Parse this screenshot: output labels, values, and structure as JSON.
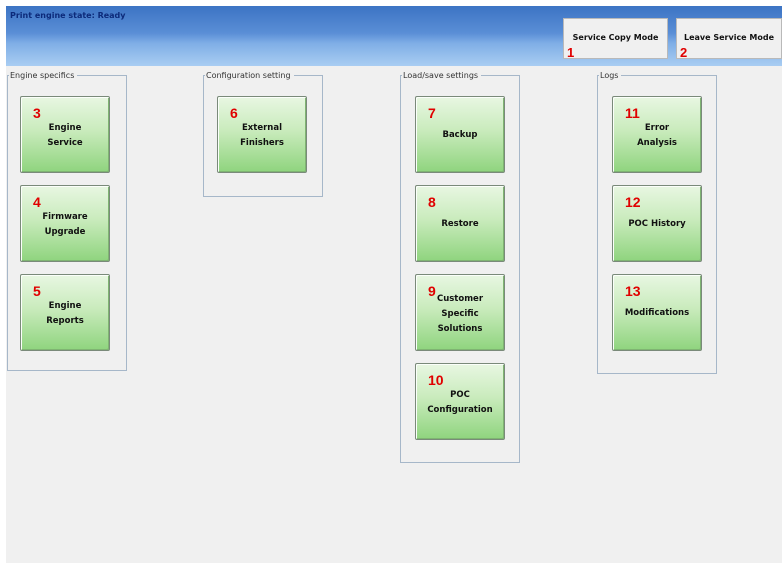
{
  "status": "Print engine state: Ready",
  "header_buttons": [
    {
      "num": "1",
      "label": "Service Copy Mode"
    },
    {
      "num": "2",
      "label": "Leave Service Mode"
    }
  ],
  "groups": {
    "engine_specifics": {
      "title": "Engine specifics",
      "tiles": [
        {
          "num": "3",
          "label": "Engine\nService"
        },
        {
          "num": "4",
          "label": "Firmware\nUpgrade"
        },
        {
          "num": "5",
          "label": "Engine\nReports"
        }
      ]
    },
    "configuration_setting": {
      "title": "Configuration setting",
      "tiles": [
        {
          "num": "6",
          "label": "External\nFinishers"
        }
      ]
    },
    "load_save_settings": {
      "title": "Load/save settings",
      "tiles": [
        {
          "num": "7",
          "label": "Backup"
        },
        {
          "num": "8",
          "label": "Restore"
        },
        {
          "num": "9",
          "label": "Customer\nSpecific\nSolutions"
        },
        {
          "num": "10",
          "label": "POC\nConfiguration"
        }
      ]
    },
    "logs": {
      "title": "Logs",
      "tiles": [
        {
          "num": "11",
          "label": "Error\nAnalysis"
        },
        {
          "num": "12",
          "label": "POC History"
        },
        {
          "num": "13",
          "label": "Modifications"
        }
      ]
    }
  }
}
